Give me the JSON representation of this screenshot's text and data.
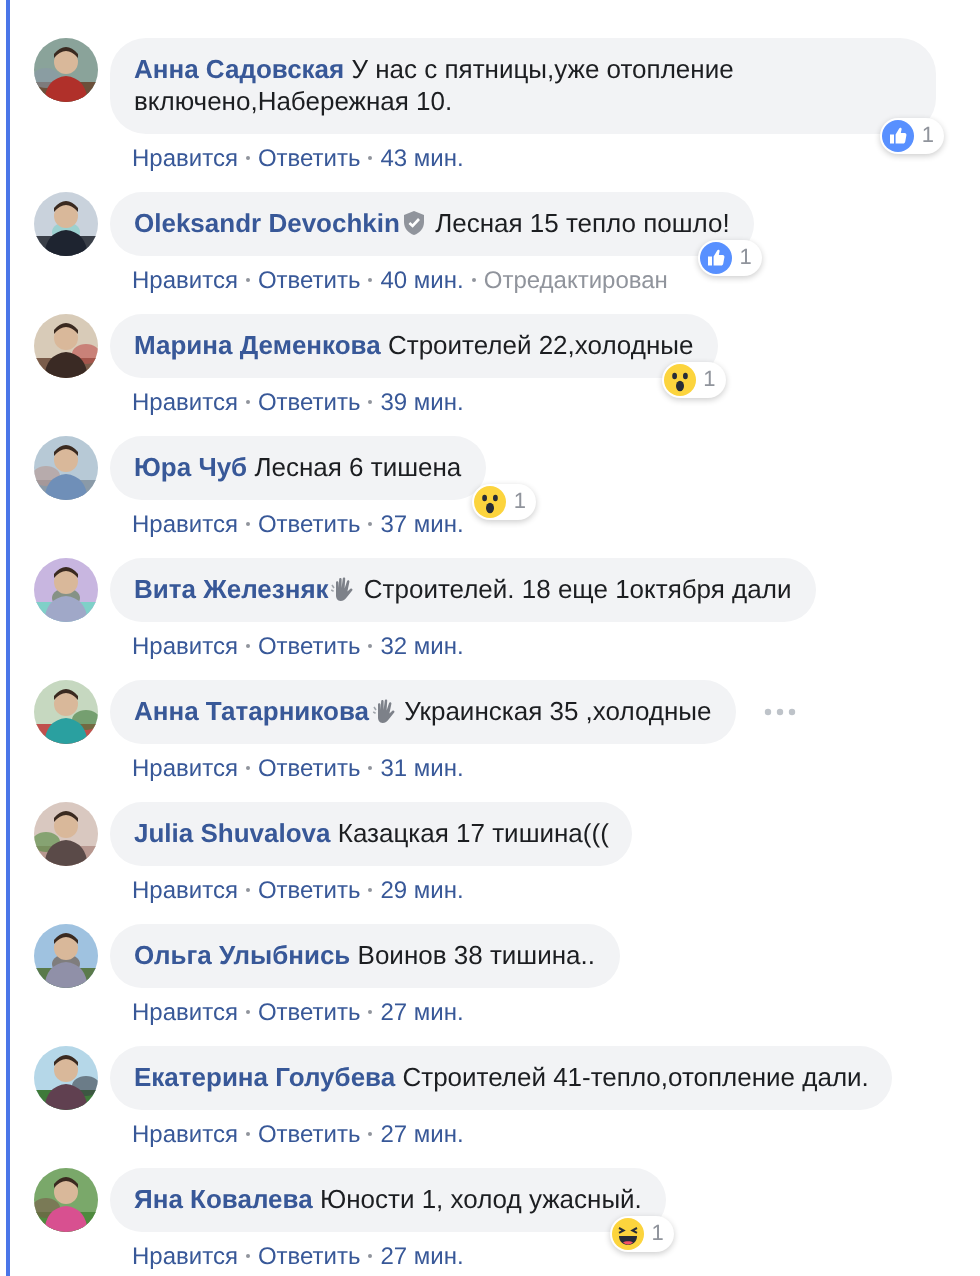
{
  "comments": [
    {
      "author": "Анна Садовская",
      "text": "У нас с пятницы,уже отопление включено,Набережная 10.",
      "reaction": {
        "kind": "like",
        "count": "1"
      },
      "like": "Нравится",
      "reply": "Ответить",
      "time": "43 мин.",
      "more_shown": false
    },
    {
      "author": "Oleksandr Devochkin",
      "author_badge": {
        "kind": "shield"
      },
      "text": "Лесная 15 тепло пошло!",
      "reaction": {
        "kind": "like",
        "count": "1"
      },
      "like": "Нравится",
      "reply": "Ответить",
      "time": "40 мин.",
      "edited": "Отредактирован",
      "more_shown": false
    },
    {
      "author": "Марина Деменкова",
      "text": "Строителей 22,холодные",
      "reaction": {
        "kind": "wow",
        "count": "1"
      },
      "like": "Нравится",
      "reply": "Ответить",
      "time": "39 мин.",
      "more_shown": false
    },
    {
      "author": "Юра Чуб",
      "text": "Лесная 6 тишена",
      "reaction": {
        "kind": "wow",
        "count": "1"
      },
      "like": "Нравится",
      "reply": "Ответить",
      "time": "37 мин.",
      "more_shown": false
    },
    {
      "author": "Вита Железняк",
      "author_badge": {
        "kind": "hand"
      },
      "text": "Строителей. 18 еще 1октября дали",
      "like": "Нравится",
      "reply": "Ответить",
      "time": "32 мин.",
      "more_shown": false
    },
    {
      "author": "Анна Татарникова",
      "author_badge": {
        "kind": "hand"
      },
      "text": "Украинская 35 ,холодные",
      "like": "Нравится",
      "reply": "Ответить",
      "time": "31 мин.",
      "more_shown": true
    },
    {
      "author": "Julia Shuvalova",
      "text": "Казацкая 17 тишина(((",
      "like": "Нравится",
      "reply": "Ответить",
      "time": "29 мин.",
      "more_shown": false
    },
    {
      "author": "Ольга Улыбнись",
      "text": "Воинов 38 тишина..",
      "like": "Нравится",
      "reply": "Ответить",
      "time": "27 мин.",
      "more_shown": false
    },
    {
      "author": "Екатерина Голубева",
      "text": "Строителей 41-тепло,отопление дали.",
      "like": "Нравится",
      "reply": "Ответить",
      "time": "27 мин.",
      "more_shown": false
    },
    {
      "author": "Яна Ковалева",
      "text": "Юности 1, холод ужасный.",
      "reaction": {
        "kind": "haha",
        "count": "1"
      },
      "like": "Нравится",
      "reply": "Ответить",
      "time": "27 мин.",
      "more_shown": false
    }
  ]
}
